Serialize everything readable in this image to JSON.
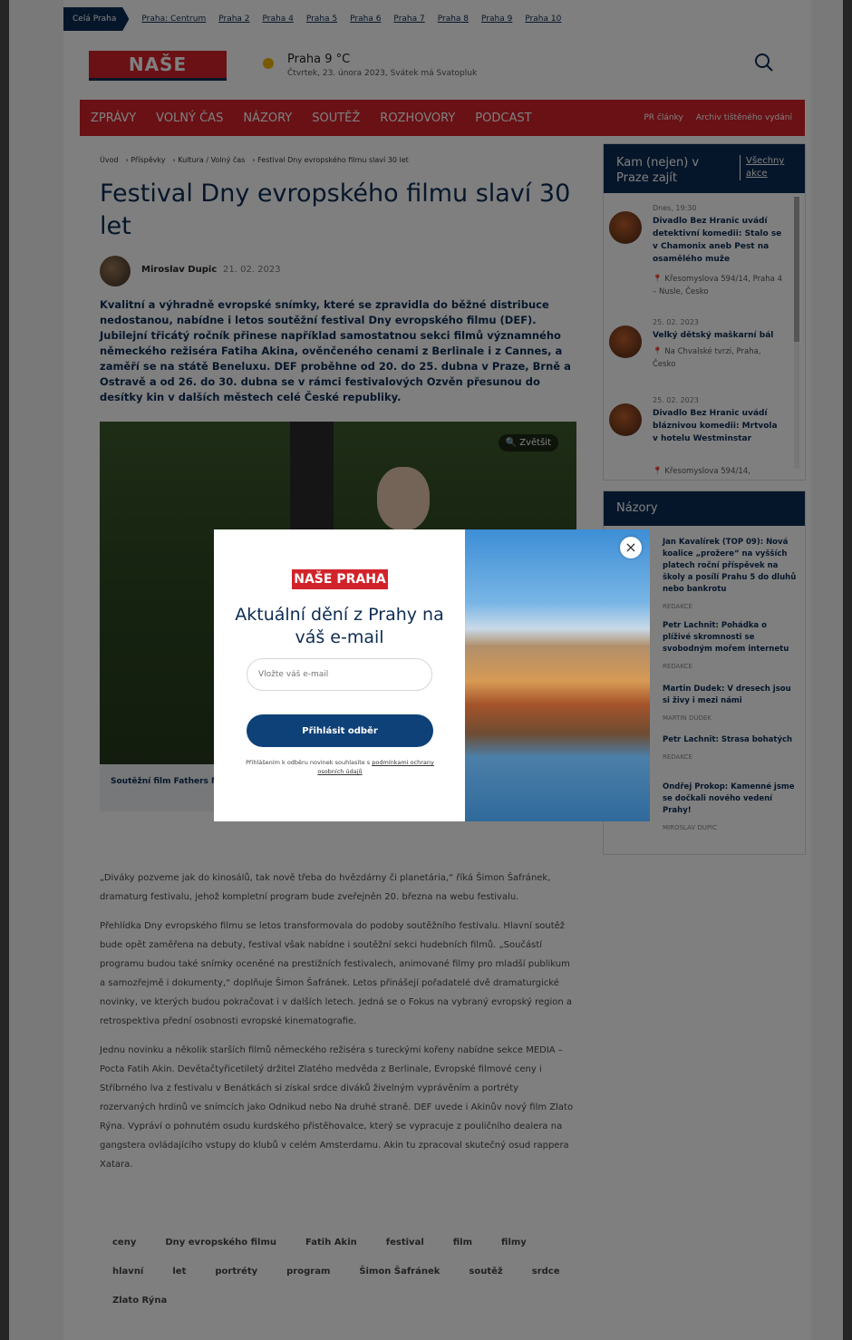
{
  "districts": {
    "all_label": "Celá Praha",
    "items": [
      "Praha: Centrum",
      "Praha 2",
      "Praha 4",
      "Praha 5",
      "Praha 6",
      "Praha 7",
      "Praha 8",
      "Praha 9",
      "Praha 10"
    ]
  },
  "header": {
    "logo": "NAŠE PRAHA",
    "weather_city": "Praha 9 °C",
    "weather_date": "Čtvrtek, 23. února 2023, Svátek má Svatopluk"
  },
  "nav": {
    "items": [
      "Zprávy",
      "Volný čas",
      "Názory",
      "Soutěž",
      "Rozhovory",
      "Podcast"
    ],
    "right": [
      "PR články",
      "Archiv tištěného vydání"
    ]
  },
  "breadcrumb": [
    "Úvod",
    "Příspěvky",
    "Kultura / Volný čas",
    "Festival Dny evropského filmu slaví 30 let"
  ],
  "article": {
    "title": "Festival Dny evropského filmu slaví 30 let",
    "author": "Miroslav Dupic",
    "date": "21. 02. 2023",
    "lead": "Kvalitní a výhradně evropské snímky, které se zpravidla do běžné distribuce nedostanou, nabídne i letos soutěžní festival Dny evropského filmu (DEF). Jubilejní třicátý ročník přinese například samostatnou sekci filmů významného německého režiséra Fatiha Akina, ověnčeného cenami z Berlinale i z Cannes, a zaměří se na státě Beneluxu. DEF proběhne od 20. do 25. dubna v Praze, Brně a Ostravě a od 26. do 30. dubna se v rámci festivalových Ozvěn přesunou do desítky kin v dalších městech celé České republiky.",
    "zoom_label": "Zvětšit",
    "caption": "Soutěžní film Fathers Mo... festivalu evropského filmu",
    "paragraphs": [
      "„Diváky pozveme jak do kinosálů, tak nově třeba do hvězdárny či planetária,“ říká Šimon Šafránek, dramaturg festivalu, jehož kompletní program bude zveřejněn 20. března na webu festivalu.",
      "Přehlídka Dny evropského filmu se letos transformovala do podoby soutěžního festivalu. Hlavní soutěž bude opět zaměřena na debuty, festival však nabídne i soutěžní sekci hudebních filmů. „Součástí programu budou také snímky oceněné na prestižních festivalech, animované filmy pro mladší publikum a samozřejmě i dokumenty,“ doplňuje Šimon Šafránek. Letos přinášejí pořadatelé dvě dramaturgické novinky, ve kterých budou pokračovat i v dalších letech. Jedná se o Fokus na vybraný evropský region a retrospektiva přední osobnosti evropské kinematografie.",
      "Jednu novinku a několik starších filmů německého režiséra s tureckými kořeny nabídne sekce MEDIA – Pocta Fatih Akin. Devětačtyřicetiletý držitel Zlatého medvěda z Berlinale, Evropské filmové ceny i Stříbrného lva z festivalu v Benátkách si získal srdce diváků živelným vyprávěním a portréty rozervaných hrdinů ve snímcích jako Odnikud nebo Na druhé straně. DEF uvede i Akinův nový film Zlato Rýna. Vypráví o pohnutém osudu kurdského přistěhovalce, který se vypracuje z pouličního dealera na gangstera ovládajícího vstupy do klubů v celém Amsterdamu. Akin tu zpracoval skutečný osud rappera Xatara."
    ]
  },
  "tags": [
    "ceny",
    "Dny evropského filmu",
    "Fatih Akin",
    "festival",
    "film",
    "filmy",
    "hlavní",
    "let",
    "portréty",
    "program",
    "Šimon Šafránek",
    "soutěž",
    "srdce",
    "Zlato Rýna"
  ],
  "events": {
    "title": "Kam (nejen) v Praze zajít",
    "all_link": "Všechny akce",
    "items": [
      {
        "date": "Dnes, 19:30",
        "title": "Divadlo Bez Hranic uvádí detektivní komedii: Stalo se v Chamonix aneb Pest na osamělého muže",
        "location": "Křesomyslova 594/14, Praha 4 – Nusle, Česko"
      },
      {
        "date": "25. 02. 2023",
        "title": "Velký dětský maškarní bál",
        "location": "Na Chvalské tvrzi, Praha, Česko"
      },
      {
        "date": "25. 02. 2023",
        "title": "Divadlo Bez Hranic uvádí bláznivou komedii: Mrtvola v hotelu Westminstar",
        "location": "Křesomyslova 594/14,"
      }
    ]
  },
  "opinions": {
    "title": "Názory",
    "items": [
      {
        "title": "Jan Kavalírek (TOP 09): Nová koalice „prožere“ na vyšších platech roční příspěvek na školy a posílí Prahu 5 do dluhů nebo bankrotu",
        "author": "Redakce"
      },
      {
        "title": "Petr Lachnit: Pohádka o plíživé skromnosti se svobodným mořem internetu",
        "author": "Redakce"
      },
      {
        "title": "Martin Dudek: V dresech jsou si živy i mezi námi",
        "author": "Martin Dudek"
      },
      {
        "title": "Petr Lachnit: Strasa bohatých",
        "author": "Redakce"
      },
      {
        "title": "Ondřej Prokop: Kamenné jsme se dočkali nového vedení Prahy!",
        "author": "Miroslav Dupic"
      }
    ]
  },
  "modal": {
    "logo": "NAŠE PRAHA",
    "heading": "Aktuální dění z Prahy na váš e-mail",
    "email_placeholder": "Vložte váš e-mail",
    "submit": "Přihlásit odběr",
    "terms_text": "Přihlášením k odběru novinek souhlasíte s ",
    "terms_link": "podmínkami ochrany osobních údajů",
    "close": "×"
  },
  "colors": {
    "brand_red": "#d2232a",
    "brand_navy": "#0d2c54",
    "button_blue": "#0d4178"
  }
}
